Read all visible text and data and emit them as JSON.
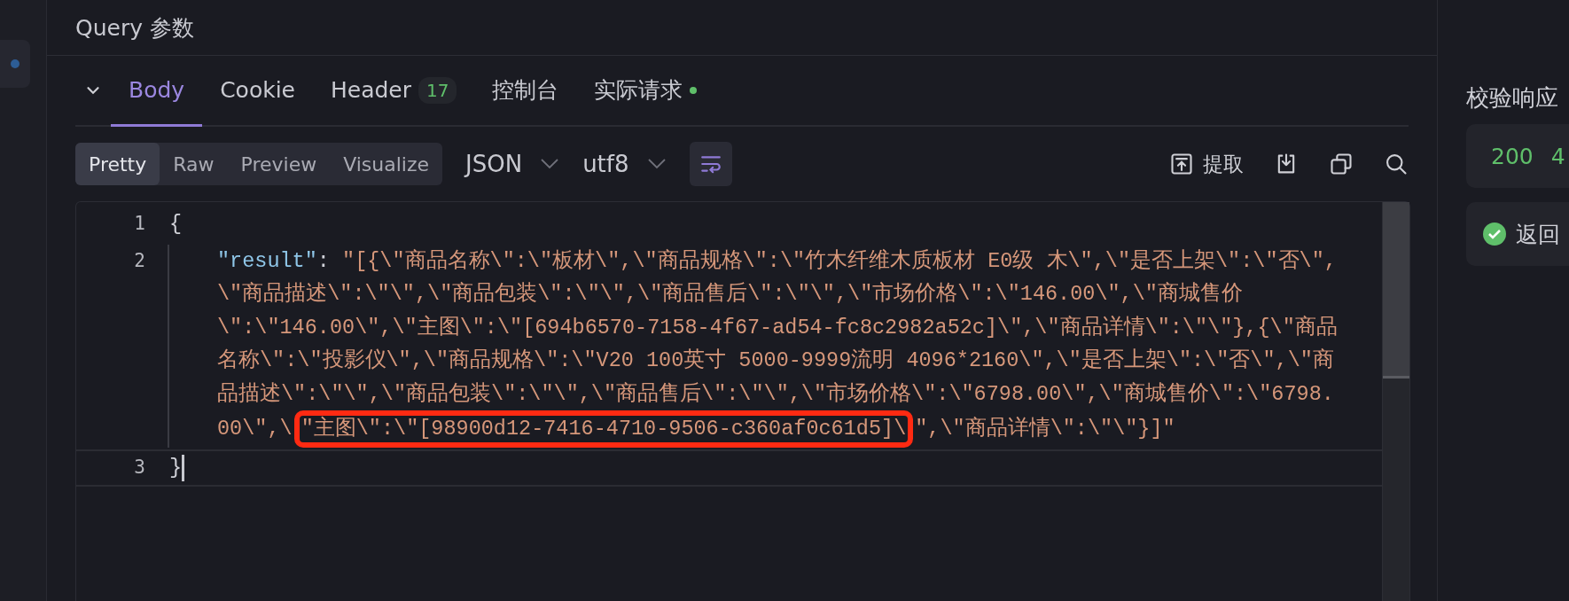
{
  "header": {
    "title": "Query 参数"
  },
  "tabs": [
    {
      "label": "Body",
      "selected": true
    },
    {
      "label": "Cookie",
      "selected": false
    },
    {
      "label": "Header",
      "selected": false,
      "badge": "17"
    },
    {
      "label": "控制台",
      "selected": false
    },
    {
      "label": "实际请求",
      "selected": false,
      "color": "#5fbf6a"
    }
  ],
  "view_modes": [
    {
      "label": "Pretty",
      "selected": true
    },
    {
      "label": "Raw",
      "selected": false
    },
    {
      "label": "Preview",
      "selected": false
    },
    {
      "label": "Visualize",
      "selected": false
    }
  ],
  "dropdowns": [
    {
      "label": "JSON"
    },
    {
      "label": "utf8"
    }
  ],
  "wrap_toggle": {
    "on": true
  },
  "actions": [
    {
      "kind": "extract",
      "label": "提取"
    },
    {
      "kind": "download"
    },
    {
      "kind": "copy"
    },
    {
      "kind": "search"
    }
  ],
  "editor": {
    "lines": [
      {
        "number": "1",
        "current": false,
        "text": "{"
      },
      {
        "number": "2",
        "current": false,
        "key": "\"result\"",
        "separator": ":",
        "segments": [
          "\"[{\\\"商品名称\\\":\\\"板材\\\",\\\"商品规格\\\":\\\"竹木纤维木质板材 E0级 木\\\",\\\"是否上架\\\":\\\"否\\\",",
          "\\\"商品描述\\\":\\\"\\\",\\\"商品包装\\\":\\\"\\\",\\\"商品售后\\\":\\\"\\\",\\\"市场价格\\\":\\\"146.00\\\",\\\"商城售价",
          "\\\":\\\"146.00\\\",\\\"主图\\\":\\\"[694b6570-7158-4f67-ad54-fc8c2982a52c]\\\",\\\"商品详情\\\":\\\"\\\"},{\\\"商品",
          "名称\\\":\\\"投影仪\\\",\\\"商品规格\\\":\\\"V20 100英寸 5000-9999流明 4096*2160\\\",\\\"是否上架\\\":\\\"否\\\",\\\"商",
          "品描述\\\":\\\"\\\",\\\"商品包装\\\":\\\"\\\",\\\"商品售后\\\":\\\"\\\",\\\"市场价格\\\":\\\"6798.00\\\",\\\"商城售价\\\":\\\"6798.",
          {
            "before": "00\\\",\\",
            "marked": "\"主图\\\":\\\"[98900d12-7416-4710-9506-c360af0c61d5]\\",
            "after": "\",\\\"商品详情\\\":\\\"\\\"}]\""
          }
        ]
      },
      {
        "number": "3",
        "current": true,
        "text": "}"
      }
    ]
  },
  "side_panel": {
    "title": "校验响应",
    "status_codes": [
      "200",
      "4"
    ],
    "check": {
      "label": "返回",
      "passed": true
    }
  }
}
